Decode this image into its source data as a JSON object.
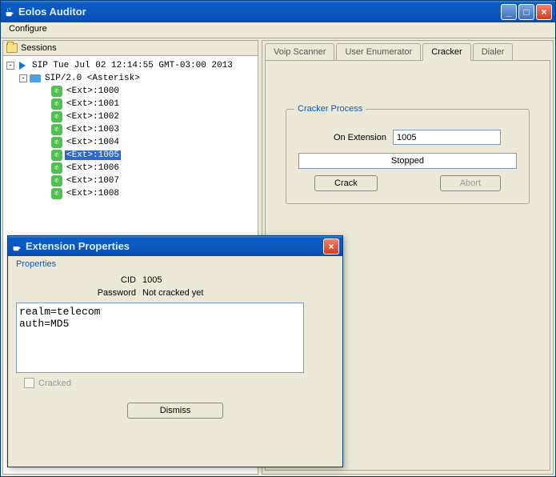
{
  "window": {
    "title": "Eolos Auditor"
  },
  "menubar": {
    "configure": "Configure"
  },
  "sessions": {
    "header": "Sessions",
    "root_label": "SIP Tue Jul 02 12:14:55 GMT-03:00 2013",
    "sip_label": "SIP/2.0 <Asterisk>",
    "extensions": [
      {
        "label": "<Ext>:1000",
        "selected": false
      },
      {
        "label": "<Ext>:1001",
        "selected": false
      },
      {
        "label": "<Ext>:1002",
        "selected": false
      },
      {
        "label": "<Ext>:1003",
        "selected": false
      },
      {
        "label": "<Ext>:1004",
        "selected": false
      },
      {
        "label": "<Ext>:1005",
        "selected": true
      },
      {
        "label": "<Ext>:1006",
        "selected": false
      },
      {
        "label": "<Ext>:1007",
        "selected": false
      },
      {
        "label": "<Ext>:1008",
        "selected": false
      }
    ]
  },
  "tabs": {
    "items": [
      {
        "label": "Voip Scanner",
        "active": false
      },
      {
        "label": "User Enumerator",
        "active": false
      },
      {
        "label": "Cracker",
        "active": true
      },
      {
        "label": "Dialer",
        "active": false
      }
    ]
  },
  "cracker": {
    "legend": "Cracker Process",
    "extension_label": "On Extension",
    "extension_value": "1005",
    "status": "Stopped",
    "crack_btn": "Crack",
    "abort_btn": "Abort"
  },
  "dialog": {
    "title": "Extension Properties",
    "section": "Properties",
    "cid_label": "CID",
    "cid_value": "1005",
    "password_label": "Password",
    "password_value": "Not cracked yet",
    "details": "realm=telecom\nauth=MD5",
    "cracked_label": "Cracked",
    "dismiss": "Dismiss"
  }
}
